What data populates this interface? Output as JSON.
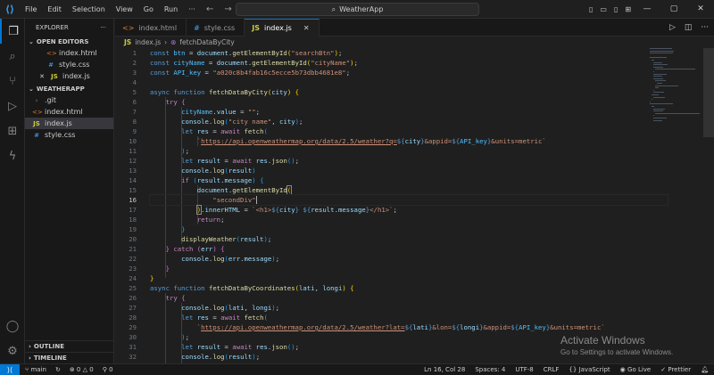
{
  "titlebar": {
    "menu": [
      "File",
      "Edit",
      "Selection",
      "View",
      "Go",
      "Run"
    ],
    "more": "···",
    "search": "WeatherApp"
  },
  "sidebar": {
    "header": "EXPLORER",
    "more": "···",
    "open_editors_label": "OPEN EDITORS",
    "open_editors": [
      {
        "name": "index.html",
        "type": "html"
      },
      {
        "name": "style.css",
        "type": "css"
      },
      {
        "name": "index.js",
        "type": "js"
      }
    ],
    "folder_label": "WEATHERAPP",
    "files": [
      {
        "name": ".git",
        "type": "folder"
      },
      {
        "name": "index.html",
        "type": "html"
      },
      {
        "name": "index.js",
        "type": "js"
      },
      {
        "name": "style.css",
        "type": "css"
      }
    ],
    "outline_label": "OUTLINE",
    "timeline_label": "TIMELINE"
  },
  "tabs": [
    {
      "label": "index.html",
      "type": "html"
    },
    {
      "label": "style.css",
      "type": "css"
    },
    {
      "label": "index.js",
      "type": "js",
      "active": true
    }
  ],
  "breadcrumb": {
    "file": "index.js",
    "symbol": "fetchDataByCity"
  },
  "editor": {
    "current_line": 16,
    "line_numbers": [
      1,
      2,
      3,
      4,
      5,
      6,
      7,
      8,
      9,
      10,
      11,
      12,
      13,
      14,
      15,
      16,
      17,
      18,
      19,
      20,
      21,
      22,
      23,
      24,
      25,
      26,
      27,
      28,
      29,
      30,
      31,
      32,
      33
    ]
  },
  "watermark": {
    "title": "Activate Windows",
    "subtitle": "Go to Settings to activate Windows."
  },
  "statusbar": {
    "branch": "main",
    "sync": "↻",
    "errors": "0",
    "warnings": "0",
    "ports": "0",
    "position": "Ln 16, Col 28",
    "spaces": "Spaces: 4",
    "encoding": "UTF-8",
    "eol": "CRLF",
    "language": "JavaScript",
    "golive": "Go Live",
    "prettier": "Prettier"
  },
  "colors": {
    "accent": "#0078d4",
    "background": "#1e1e1e",
    "sidebar": "#181818"
  }
}
